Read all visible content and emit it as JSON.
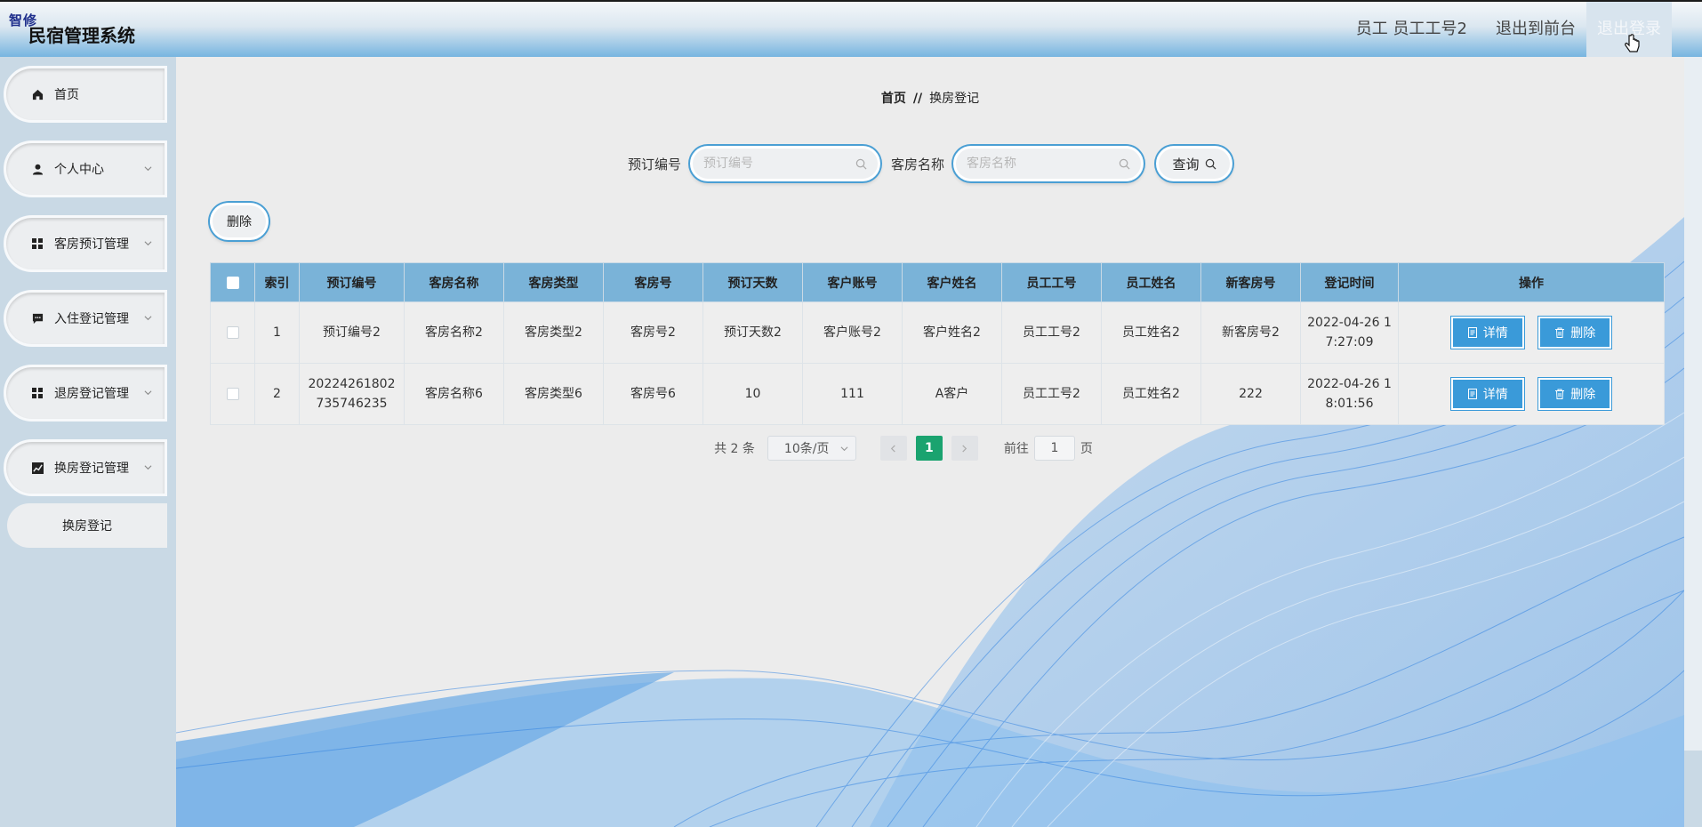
{
  "header": {
    "badge": "智修",
    "title": "民宿管理系统",
    "user_label": "员工 员工工号2",
    "to_front": "退出到前台",
    "logout": "退出登录"
  },
  "sidebar": {
    "items": [
      {
        "label": "首页",
        "icon": "home-icon",
        "has_children": false
      },
      {
        "label": "个人中心",
        "icon": "user-icon",
        "has_children": true
      },
      {
        "label": "客房预订管理",
        "icon": "grid-icon",
        "has_children": true
      },
      {
        "label": "入住登记管理",
        "icon": "message-icon",
        "has_children": true
      },
      {
        "label": "退房登记管理",
        "icon": "grid-icon",
        "has_children": true
      },
      {
        "label": "换房登记管理",
        "icon": "chart-icon",
        "has_children": true
      }
    ],
    "sub_item": "换房登记"
  },
  "breadcrumb": {
    "home": "首页",
    "separator": "//",
    "current": "换房登记"
  },
  "search": {
    "label1": "预订编号",
    "placeholder1": "预订编号",
    "label2": "客房名称",
    "placeholder2": "客房名称",
    "query_label": "查询"
  },
  "toolbar": {
    "delete_label": "删除"
  },
  "table": {
    "headers": [
      "索引",
      "预订编号",
      "客房名称",
      "客房类型",
      "客房号",
      "预订天数",
      "客户账号",
      "客户姓名",
      "员工工号",
      "员工姓名",
      "新客房号",
      "登记时间",
      "操作"
    ],
    "rows": [
      {
        "index": "1",
        "order_no": "预订编号2",
        "room_name": "客房名称2",
        "room_type": "客房类型2",
        "room_no": "客房号2",
        "days": "预订天数2",
        "account": "客户账号2",
        "customer": "客户姓名2",
        "staff_no": "员工工号2",
        "staff_name": "员工姓名2",
        "new_room": "新客房号2",
        "time": "2022-04-26 1\n7:27:09"
      },
      {
        "index": "2",
        "order_no": "20224261802\n735746235",
        "room_name": "客房名称6",
        "room_type": "客房类型6",
        "room_no": "客房号6",
        "days": "10",
        "account": "111",
        "customer": "A客户",
        "staff_no": "员工工号2",
        "staff_name": "员工姓名2",
        "new_room": "222",
        "time": "2022-04-26 1\n8:01:56"
      }
    ],
    "detail_label": "详情",
    "delete_label": "删除"
  },
  "pagination": {
    "total": "共 2 条",
    "page_size": "10条/页",
    "current_page": "1",
    "goto_prefix": "前往",
    "goto_value": "1",
    "goto_suffix": "页"
  },
  "colors": {
    "header_accent": "#77b5e0",
    "table_header": "#7ab3d8",
    "button_blue": "#3a9ad9",
    "page_active": "#1aa36f"
  }
}
